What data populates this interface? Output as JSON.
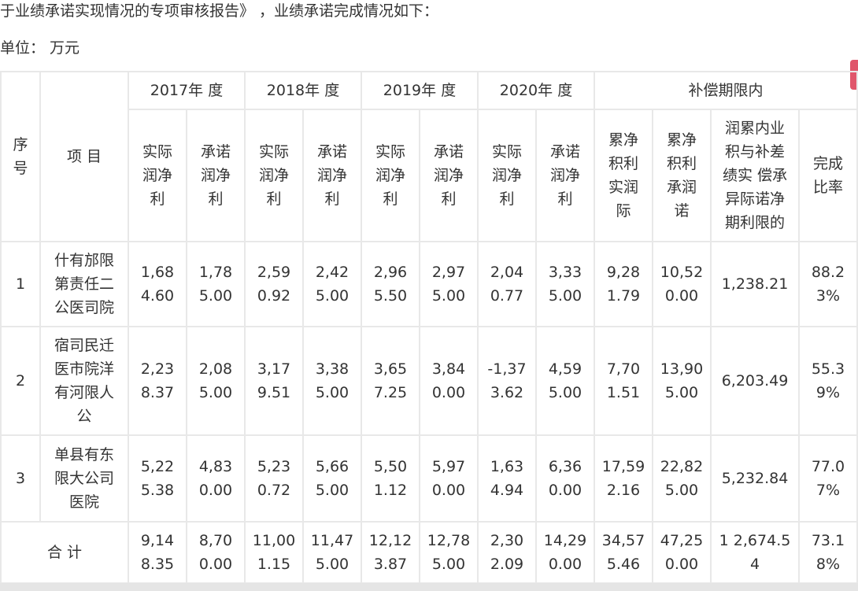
{
  "intro_text": "于业绩承诺实现情况的专项审核报告》 ，业绩承诺完成情况如下：",
  "unit_text": "单位： 万元",
  "colors": {
    "border": "#e8e8e8",
    "text": "#333333",
    "scroll_marker": "#e0566b"
  },
  "table": {
    "header": {
      "seq": [
        "序",
        "号"
      ],
      "item": "项 目",
      "years": [
        "2017年 度",
        "2018年 度",
        "2019年 度",
        "2020年 度"
      ],
      "comp_period": "补偿期限内",
      "actual": [
        "实际",
        "润净",
        "利"
      ],
      "promised": [
        "承诺",
        "润净",
        "利"
      ],
      "cum_actual": [
        "累净",
        "积利",
        "实润",
        "际"
      ],
      "cum_promised": [
        "累净",
        "积利",
        "承润",
        "诺"
      ],
      "diff": [
        "润累内业",
        "积与补差",
        "绩实 偿承",
        "异际诺净",
        "期利限的"
      ],
      "rate": [
        "完成",
        "比率"
      ]
    },
    "rows": [
      {
        "seq": "1",
        "name": [
          "什有邡限",
          "第责任二",
          "公医司院"
        ],
        "values": [
          [
            "1,68",
            "4.60"
          ],
          [
            "1,78",
            "5.00"
          ],
          [
            "2,59",
            "0.92"
          ],
          [
            "2,42",
            "5.00"
          ],
          [
            "2,96",
            "5.50"
          ],
          [
            "2,97",
            "5.00"
          ],
          [
            "2,04",
            "0.77"
          ],
          [
            "3,33",
            "5.00"
          ],
          [
            "9,28",
            "1.79"
          ],
          [
            "10,52",
            "0.00"
          ]
        ],
        "diff": "1,238.21",
        "rate": [
          "88.2",
          "3%"
        ]
      },
      {
        "seq": "2",
        "name": [
          "宿司民迁",
          "医市院洋",
          "有河限人",
          "公"
        ],
        "values": [
          [
            "2,23",
            "8.37"
          ],
          [
            "2,08",
            "5.00"
          ],
          [
            "3,17",
            "9.51"
          ],
          [
            "3,38",
            "5.00"
          ],
          [
            "3,65",
            "7.25"
          ],
          [
            "3,84",
            "0.00"
          ],
          [
            "-1,37",
            "3.62"
          ],
          [
            "4,59",
            "5.00"
          ],
          [
            "7,70",
            "1.51"
          ],
          [
            "13,90",
            "5.00"
          ]
        ],
        "diff": "6,203.49",
        "rate": [
          "55.3",
          "9%"
        ]
      },
      {
        "seq": "3",
        "name": [
          "单县有东",
          "限大公司",
          "医院"
        ],
        "values": [
          [
            "5,22",
            "5.38"
          ],
          [
            "4,83",
            "0.00"
          ],
          [
            "5,23",
            "0.72"
          ],
          [
            "5,66",
            "5.00"
          ],
          [
            "5,50",
            "1.12"
          ],
          [
            "5,97",
            "0.00"
          ],
          [
            "1,63",
            "4.94"
          ],
          [
            "6,36",
            "0.00"
          ],
          [
            "17,59",
            "2.16"
          ],
          [
            "22,82",
            "5.00"
          ]
        ],
        "diff": "5,232.84",
        "rate": [
          "77.0",
          "7%"
        ]
      }
    ],
    "total": {
      "label": "合 计",
      "values": [
        [
          "9,14",
          "8.35"
        ],
        [
          "8,70",
          "0.00"
        ],
        [
          "11,00",
          "1.15"
        ],
        [
          "11,47",
          "5.00"
        ],
        [
          "12,12",
          "3.87"
        ],
        [
          "12,78",
          "5.00"
        ],
        [
          "2,30",
          "2.09"
        ],
        [
          "14,29",
          "0.00"
        ],
        [
          "34,57",
          "5.46"
        ],
        [
          "47,25",
          "0.00"
        ]
      ],
      "diff": [
        "1 2,674.5",
        "4"
      ],
      "rate": [
        "73.1",
        "8%"
      ]
    }
  }
}
